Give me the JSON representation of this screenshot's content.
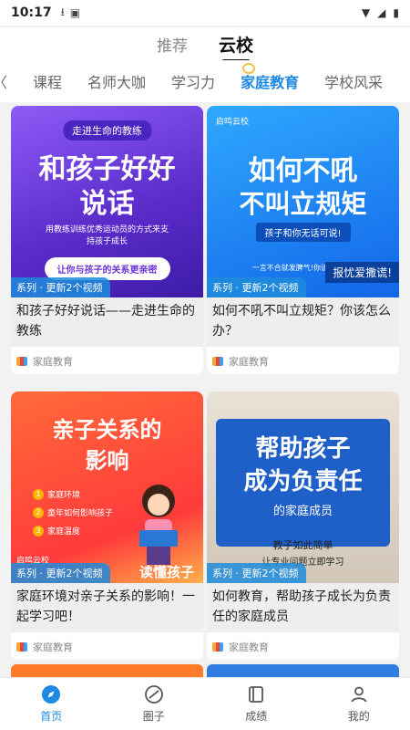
{
  "status": {
    "time": "10:17"
  },
  "top_tabs": [
    {
      "label": "推荐",
      "active": false
    },
    {
      "label": "云校",
      "active": true
    }
  ],
  "category_tabs": [
    {
      "label": "课程",
      "active": false
    },
    {
      "label": "名师大咖",
      "active": false
    },
    {
      "label": "学习力",
      "active": false
    },
    {
      "label": "家庭教育",
      "active": true
    },
    {
      "label": "学校风采",
      "active": false
    }
  ],
  "cards": [
    {
      "thumb": {
        "top_text": "走进生命的教练",
        "headline_1": "和孩子好好",
        "headline_2": "说话",
        "desc_1": "用教练训练优秀运动员的方式来支",
        "desc_2": "持孩子成长",
        "button": "让你与孩子的关系更亲密"
      },
      "badge": "系列 · 更新2个视频",
      "title": "和孩子好好说话——走进生命的教练",
      "source": "家庭教育"
    },
    {
      "thumb": {
        "brand": "启鸣云校",
        "headline_1": "如何不吼",
        "headline_2": "不叫立规矩",
        "sub": "孩子和你无话可说!",
        "bottom_line": "一言不合就发脾气!你该怎么办?",
        "ribbon": "报忧爱撒谎!"
      },
      "badge": "系列 · 更新2个视频",
      "title": "如何不吼不叫立规矩？你该怎么办？",
      "source": "家庭教育"
    },
    {
      "thumb": {
        "headline_1": "亲子关系的",
        "headline_2": "影响",
        "items": [
          "家庭环境",
          "童年如何影响孩子",
          "家庭温度"
        ],
        "brand": "启鸣云校",
        "bottom": "读懂孩子"
      },
      "badge": "系列 · 更新2个视频",
      "title": "家庭环境对亲子关系的影响！一起学习吧！",
      "source": "家庭教育"
    },
    {
      "thumb": {
        "headline_1": "帮助孩子",
        "headline_2": "成为负责任",
        "headline_3": "的家庭成员",
        "line_1": "教子如此简单",
        "line_2": "让专业问题立即学习"
      },
      "badge": "系列 · 更新2个视频",
      "title": "如何教育，帮助孩子成长为负责任的家庭成员",
      "source": "家庭教育"
    }
  ],
  "nav": [
    {
      "label": "首页",
      "active": true,
      "icon": "compass-icon"
    },
    {
      "label": "圈子",
      "active": false,
      "icon": "circle-icon"
    },
    {
      "label": "成绩",
      "active": false,
      "icon": "book-icon"
    },
    {
      "label": "我的",
      "active": false,
      "icon": "user-icon"
    }
  ],
  "colors": {
    "accent": "#1e88e5"
  }
}
